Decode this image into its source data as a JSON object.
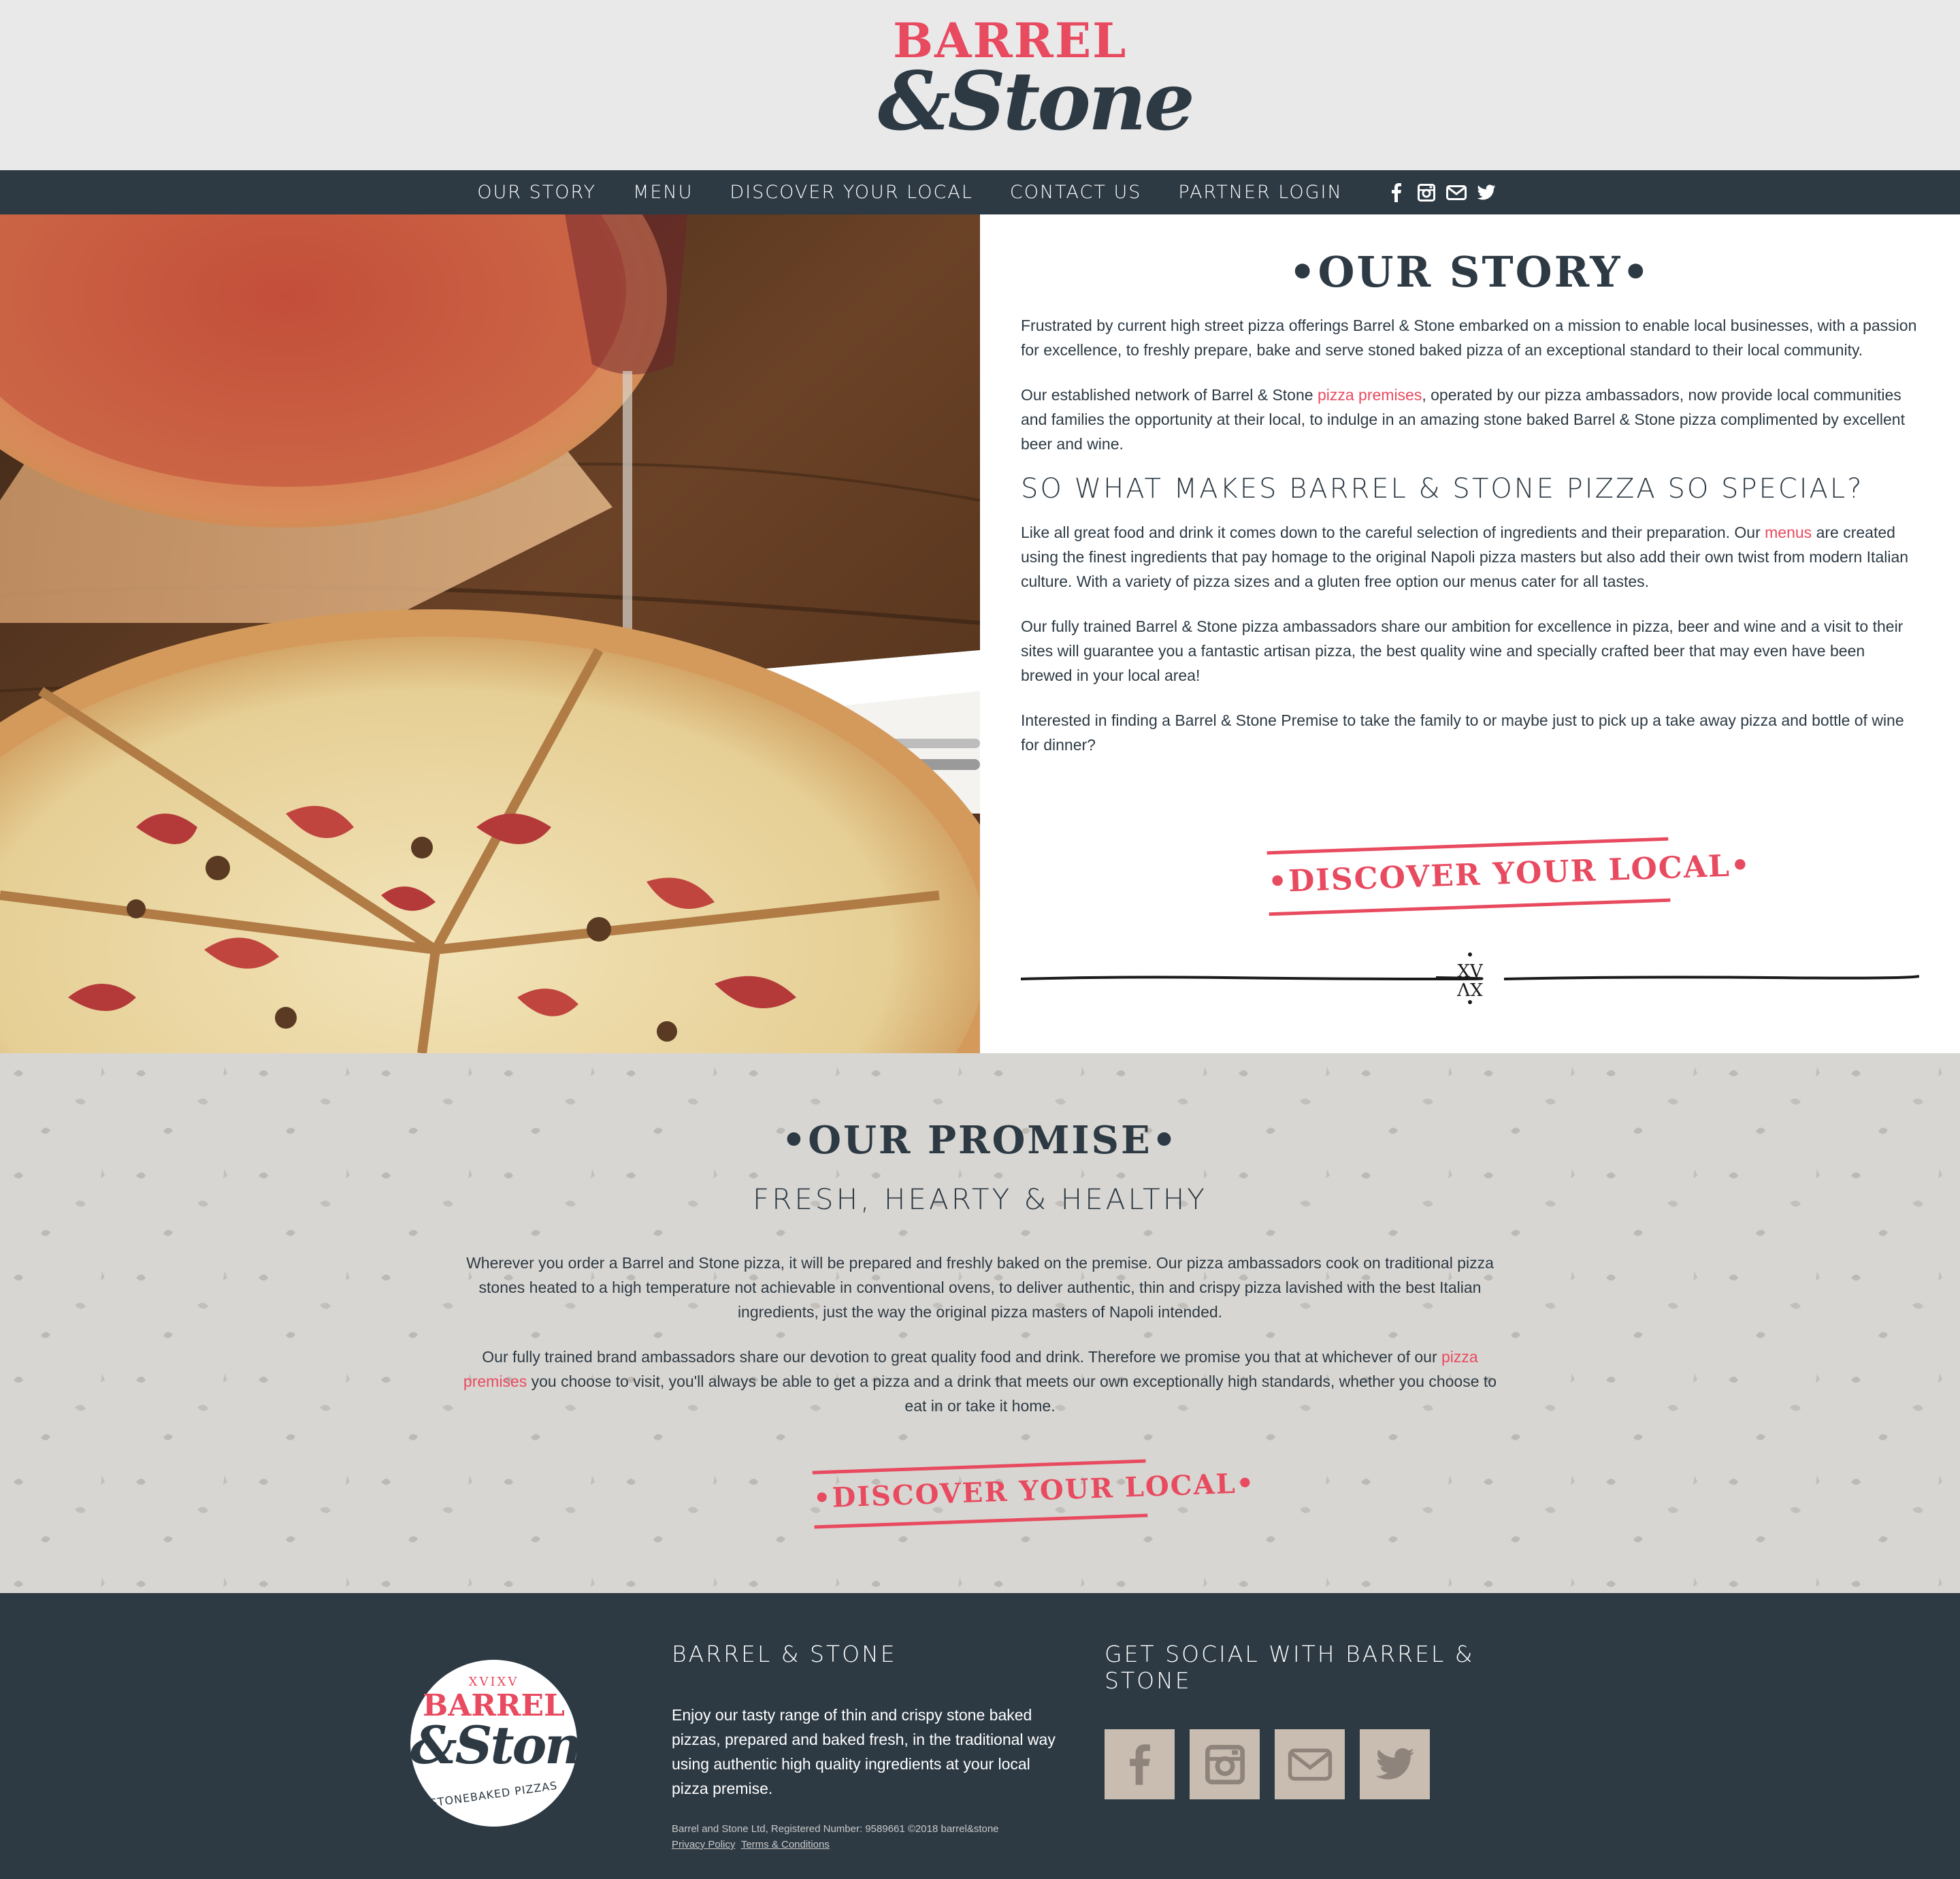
{
  "brand": {
    "logo_top": "BARREL",
    "logo_bottom": "&Stone"
  },
  "nav": {
    "items": [
      {
        "label": "OUR STORY"
      },
      {
        "label": "MENU"
      },
      {
        "label": "DISCOVER YOUR LOCAL"
      },
      {
        "label": "CONTACT US"
      },
      {
        "label": "PARTNER LOGIN"
      }
    ],
    "icons": [
      "facebook-icon",
      "instagram-icon",
      "mail-icon",
      "twitter-icon"
    ]
  },
  "story": {
    "title": "•OUR STORY•",
    "p1": "Frustrated by current high street pizza offerings Barrel & Stone embarked on a mission to enable local businesses, with a passion for excellence, to freshly prepare, bake and serve stoned baked pizza of an exceptional standard to their local community.",
    "p2_before": "Our established network of Barrel & Stone ",
    "p2_link": "pizza premises",
    "p2_after": ", operated by our pizza ambassadors, now provide local communities and families the opportunity at their local, to indulge in an amazing stone baked Barrel & Stone pizza complimented by excellent beer and wine.",
    "special_heading": "SO WHAT MAKES BARREL & STONE PIZZA SO SPECIAL?",
    "p3_before": "Like all great food and drink it comes down to the careful selection of ingredients and their preparation. Our ",
    "p3_link": "menus",
    "p3_after": " are created using the finest ingredients that pay homage to the original Napoli pizza masters but also add their own twist from modern Italian culture. With a variety of pizza sizes and a gluten free option our menus cater for all tastes.",
    "p4": "Our fully trained Barrel & Stone pizza ambassadors share our ambition for excellence in pizza, beer and wine and a visit to their sites will guarantee you a fantastic artisan pizza, the best quality wine and specially crafted beer that may even have been brewed in your local area!",
    "p5": "Interested in finding a Barrel & Stone Premise to take the family to or maybe just to pick up a take away pizza and bottle of wine for dinner?",
    "button": "•DISCOVER YOUR LOCAL•",
    "divider_mark": "XV"
  },
  "promise": {
    "title": "•OUR PROMISE•",
    "subtitle": "FRESH, HEARTY & HEALTHY",
    "p1": "Wherever you order a Barrel and Stone pizza, it will be prepared and freshly baked on the premise. Our pizza ambassadors cook on traditional pizza stones heated to a high temperature not achievable in conventional ovens, to deliver authentic, thin and crispy pizza lavished with the best Italian ingredients, just the way the original pizza masters of Napoli intended.",
    "p2_before": "Our fully trained brand ambassadors share our devotion to great quality food and drink. Therefore we promise you that at whichever of our ",
    "p2_link": "pizza premises",
    "p2_after": " you choose to visit, you'll always be able to get a pizza and a drink that meets our own exceptionally high standards, whether you choose to eat in or take it home.",
    "button": "•DISCOVER YOUR LOCAL•"
  },
  "footer": {
    "logo_small": "XVIXV",
    "logo_barrel": "BARREL",
    "logo_stone": "&Stone",
    "logo_tagline": "STONEBAKED PIZZAS",
    "heading1": "BARREL & STONE",
    "text": "Enjoy our tasty range of thin and crispy stone baked pizzas, prepared and baked fresh, in the traditional way using authentic high quality ingredients at your local pizza premise.",
    "legal": "Barrel and Stone Ltd, Registered Number: 9589661 ©2018 barrel&stone",
    "privacy": "Privacy Policy",
    "terms": "Terms & Conditions",
    "heading2": "GET SOCIAL WITH BARREL & STONE",
    "social": [
      "facebook-icon",
      "instagram-icon",
      "mail-icon",
      "twitter-icon"
    ]
  },
  "colors": {
    "navy": "#2d3a44",
    "accent": "#e84a5f",
    "social_box": "#c9bdb1"
  }
}
